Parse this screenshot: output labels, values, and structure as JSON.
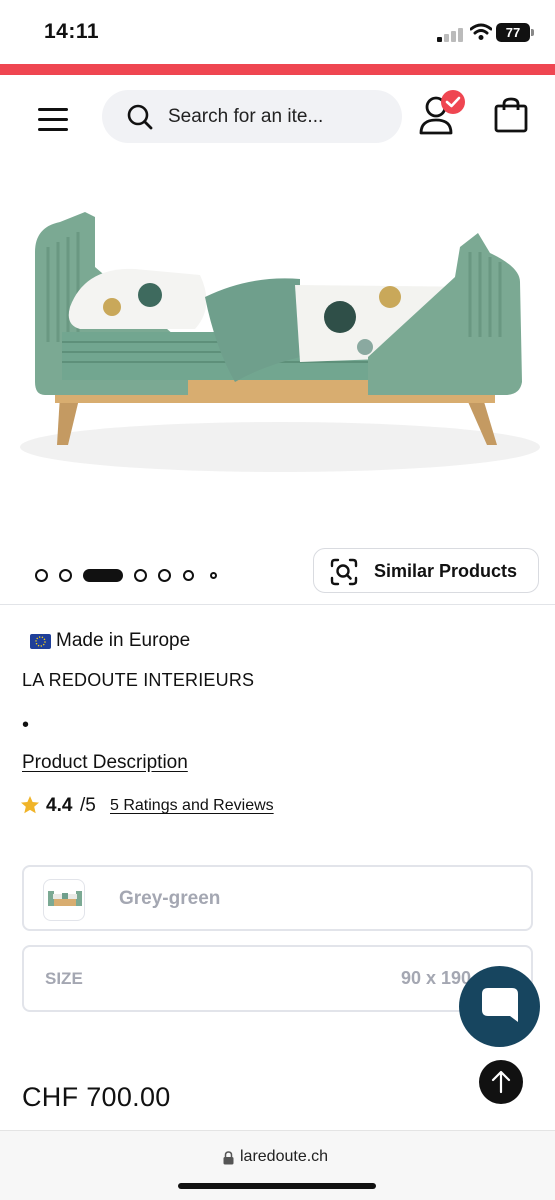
{
  "status_bar": {
    "time": "14:11",
    "battery": "77"
  },
  "header": {
    "menu_icon": "hamburger-icon",
    "search": {
      "placeholder": "Search for an ite..."
    },
    "account_icon": "user-icon",
    "account_badge_icon": "check-icon",
    "bag_icon": "shopping-bag-icon"
  },
  "colors": {
    "accent": "#ef4651",
    "chat_button": "#17455f",
    "muted_text": "#a4a7b2"
  },
  "gallery": {
    "image_alt": "Green bed with balloon-print bedding",
    "current_slide": 3,
    "total_slides": 7
  },
  "similar_products": {
    "label": "Similar Products",
    "icon": "visual-search-icon"
  },
  "product": {
    "origin_label": "Made in Europe",
    "brand": "LA REDOUTE INTERIEURS",
    "bullet": "•",
    "description_link": "Product Description",
    "rating": {
      "value": "4.4",
      "max": "/5",
      "reviews_link": "5 Ratings and Reviews"
    },
    "color": {
      "selected": "Grey-green"
    },
    "size": {
      "label": "SIZE",
      "value": "90 x 190 cm"
    },
    "price": "CHF 700.00"
  },
  "browser": {
    "url": "laredoute.ch"
  }
}
